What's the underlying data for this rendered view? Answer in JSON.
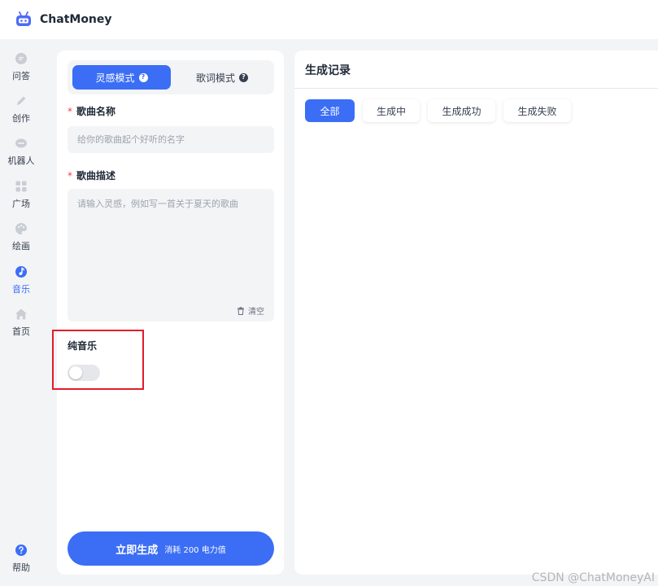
{
  "app": {
    "title": "ChatMoney",
    "logo_icon": "robot-icon"
  },
  "sidebar": {
    "items": [
      {
        "label": "问答",
        "icon": "chat-bubble-icon",
        "active": false
      },
      {
        "label": "创作",
        "icon": "pencil-icon",
        "active": false
      },
      {
        "label": "机器人",
        "icon": "robot-chat-icon",
        "active": false
      },
      {
        "label": "广场",
        "icon": "grid-icon",
        "active": false
      },
      {
        "label": "绘画",
        "icon": "palette-icon",
        "active": false
      },
      {
        "label": "音乐",
        "icon": "music-note-icon",
        "active": true
      },
      {
        "label": "首页",
        "icon": "home-icon",
        "active": false
      }
    ],
    "help": {
      "label": "帮助",
      "icon": "question-icon"
    }
  },
  "form": {
    "tabs": [
      {
        "label": "灵感模式",
        "active": true
      },
      {
        "label": "歌词模式",
        "active": false
      }
    ],
    "song_name": {
      "label": "歌曲名称",
      "required_mark": "*",
      "placeholder": "给你的歌曲起个好听的名字",
      "value": ""
    },
    "song_desc": {
      "label": "歌曲描述",
      "required_mark": "*",
      "placeholder": "请输入灵感，例如写一首关于夏天的歌曲",
      "value": ""
    },
    "clear_label": "清空",
    "pure_music": {
      "label": "纯音乐",
      "checked": false
    },
    "generate": {
      "label": "立即生成",
      "cost": "消耗 200 电力值"
    }
  },
  "records": {
    "title": "生成记录",
    "filters": [
      {
        "label": "全部",
        "active": true
      },
      {
        "label": "生成中",
        "active": false
      },
      {
        "label": "生成成功",
        "active": false
      },
      {
        "label": "生成失败",
        "active": false
      }
    ]
  },
  "watermark": "CSDN @ChatMoneyAI",
  "colors": {
    "accent": "#3b6ef5",
    "required": "#ef4444",
    "highlight": "#e11d2a"
  }
}
